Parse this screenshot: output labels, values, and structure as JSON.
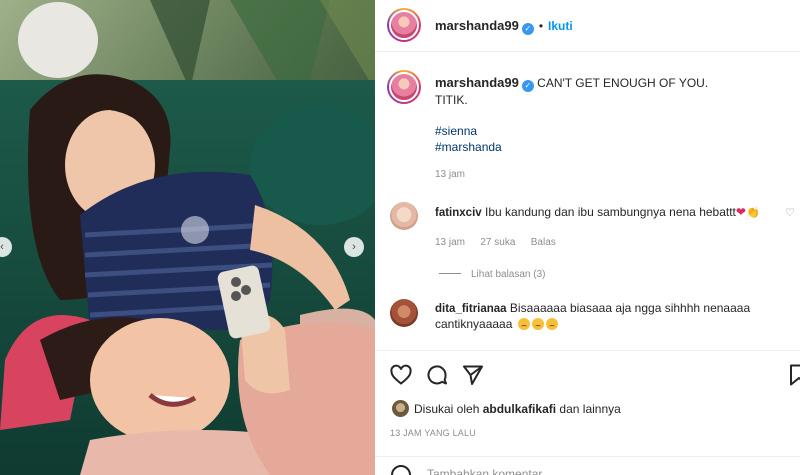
{
  "post": {
    "username": "marshanda99",
    "dot": "•",
    "follow_label": "Ikuti",
    "more_icon": "more-icon"
  },
  "caption": {
    "username": "marshanda99",
    "line1": "CAN'T GET ENOUGH OF YOU.",
    "line2": "TITIK.",
    "hashtags": [
      "#sienna",
      "#marshanda"
    ],
    "time": "13 jam"
  },
  "comments": [
    {
      "username": "fatinxciv",
      "text": "Ibu kandung dan ibu sambungnya nena hebattt",
      "time": "13 jam",
      "likes": "27 suka",
      "reply_label": "Balas",
      "view_replies": "Lihat balasan (3)"
    },
    {
      "username": "dita_fitrianaa",
      "text": "Bisaaaaaa biasaaa aja ngga sihhhh nenaaaa",
      "text2": "cantiknyaaaaa"
    }
  ],
  "actions": {
    "icons": [
      "heart-icon",
      "comment-icon",
      "share-icon",
      "bookmark-icon"
    ]
  },
  "likes": {
    "prefix": "Disukai oleh",
    "user": "abdulkafikafi",
    "suffix": "dan lainnya"
  },
  "timestamp": "13 JAM YANG LALU",
  "add_comment_placeholder": "Tambahkan komentar...",
  "colors": {
    "link": "#0095f6",
    "hashtag": "#00376b",
    "muted": "#8e8e8e",
    "heart_red": "#ed4956"
  }
}
